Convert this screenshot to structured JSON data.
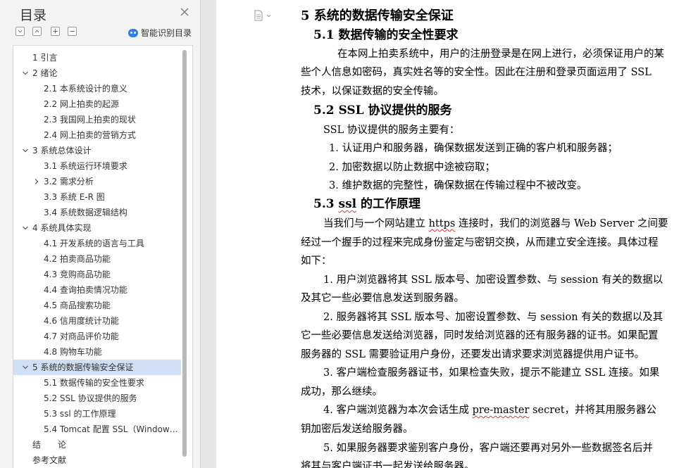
{
  "nav": {
    "title": "目录",
    "smart_toc_label": "智能识别目录",
    "items": [
      {
        "label": "1 引言",
        "level": 1,
        "arrow": ""
      },
      {
        "label": "2 绪论",
        "level": 1,
        "arrow": "down"
      },
      {
        "label": "2.1 本系统设计的意义",
        "level": 2,
        "arrow": ""
      },
      {
        "label": "2.2 网上拍卖的起源",
        "level": 2,
        "arrow": ""
      },
      {
        "label": "2.3 我国网上拍卖的现状",
        "level": 2,
        "arrow": ""
      },
      {
        "label": "2.4 网上拍卖的营销方式",
        "level": 2,
        "arrow": ""
      },
      {
        "label": "3 系统总体设计",
        "level": 1,
        "arrow": "down"
      },
      {
        "label": "3.1 系统运行环境要求",
        "level": 2,
        "arrow": ""
      },
      {
        "label": "3.2 需求分析",
        "level": 2,
        "arrow": "right"
      },
      {
        "label": "3.3 系统 E-R 图",
        "level": 2,
        "arrow": ""
      },
      {
        "label": "3.4 系统数据逻辑结构",
        "level": 2,
        "arrow": ""
      },
      {
        "label": "4 系统具体实现",
        "level": 1,
        "arrow": "down"
      },
      {
        "label": "4.1 开发系统的语言与工具",
        "level": 2,
        "arrow": ""
      },
      {
        "label": "4.2 拍卖商品功能",
        "level": 2,
        "arrow": ""
      },
      {
        "label": "4.3 竞购商品功能",
        "level": 2,
        "arrow": ""
      },
      {
        "label": "4.4 查询拍卖情况功能",
        "level": 2,
        "arrow": ""
      },
      {
        "label": "4.5 商品搜索功能",
        "level": 2,
        "arrow": ""
      },
      {
        "label": "4.6 信用度统计功能",
        "level": 2,
        "arrow": ""
      },
      {
        "label": "4.7 对商品评价功能",
        "level": 2,
        "arrow": ""
      },
      {
        "label": "4.8 购物车功能",
        "level": 2,
        "arrow": ""
      },
      {
        "label": "5 系统的数据传输安全保证",
        "level": 1,
        "arrow": "down",
        "selected": true
      },
      {
        "label": "5.1 数据传输的安全性要求",
        "level": 2,
        "arrow": ""
      },
      {
        "label": "5.2 SSL 协议提供的服务",
        "level": 2,
        "arrow": ""
      },
      {
        "label": "5.3 ssl 的工作原理",
        "level": 2,
        "arrow": ""
      },
      {
        "label": "5.4 Tomcat 配置 SSL（Window …",
        "level": 2,
        "arrow": ""
      },
      {
        "label": "结　　论",
        "level": 1,
        "arrow": ""
      },
      {
        "label": "参考文献",
        "level": 1,
        "arrow": ""
      }
    ]
  },
  "doc": {
    "h1": "5 系统的数据传输安全保证",
    "s1_title": "5.1 数据传输的安全性要求",
    "s1_p1_l1": "在本网上拍卖系统中，用户的注册登录是在网上进行，必须保证用户的某",
    "s1_p1_l2": "些个人信息如密码，真实姓名等的安全性。因此在注册和登录页面运用了 SSL",
    "s1_p1_l3": "技术，以保证数据的安全传输。",
    "s2_title": "5.2 SSL 协议提供的服务",
    "s2_intro": "SSL 协议提供的服务主要有：",
    "s2_list": [
      "1.  认证用户和服务器，确保数据发送到正确的客户机和服务器；",
      "2.  加密数据以防止数据中途被窃取；",
      "3.  维护数据的完整性，确保数据在传输过程中不被改变。"
    ],
    "s3_title_a": "5.3 ",
    "s3_title_b": "ssl",
    "s3_title_c": " 的工作原理",
    "s3_p1_l1a": "当我们与一个网站建立 ",
    "s3_p1_l1b": "https",
    "s3_p1_l1c": " 连接时，我们的浏览器与 Web Server 之间要",
    "s3_p1_l2": "经过一个握手的过程来完成身份鉴定与密钥交换，从而建立安全连接。具体过程",
    "s3_p1_l3": "如下：",
    "step1_l1": "1. 用户浏览器将其 SSL 版本号、加密设置参数、与 session 有关的数据以",
    "step1_l2": "及其它一些必要信息发送到服务器。",
    "step2_l1": "2. 服务器将其 SSL 版本号、加密设置参数、与 session 有关的数据以及其",
    "step2_l2": "它一些必要信息发送给浏览器，同时发给浏览器的还有服务器的证书。如果配置",
    "step2_l3": "服务器的 SSL 需要验证用户身份，还要发出请求要求浏览器提供用户证书。",
    "step3_l1": "3. 客户端检查服务器证书，如果检查失败，提示不能建立 SSL 连接。如果",
    "step3_l2": "成功，那么继续。",
    "step4_l1a": "4. 客户端浏览器为本次会话生成 ",
    "step4_l1b": "pre-master",
    "step4_l1c": " secret，并将其用服务器公",
    "step4_l2": "钥加密后发送给服务器。",
    "step5_l1": "5. 如果服务器要求鉴别客户身份，客户端还要再对另外一些数据签名后并",
    "step5_l2": "将其与客户端证书一起发送给服务器。"
  }
}
